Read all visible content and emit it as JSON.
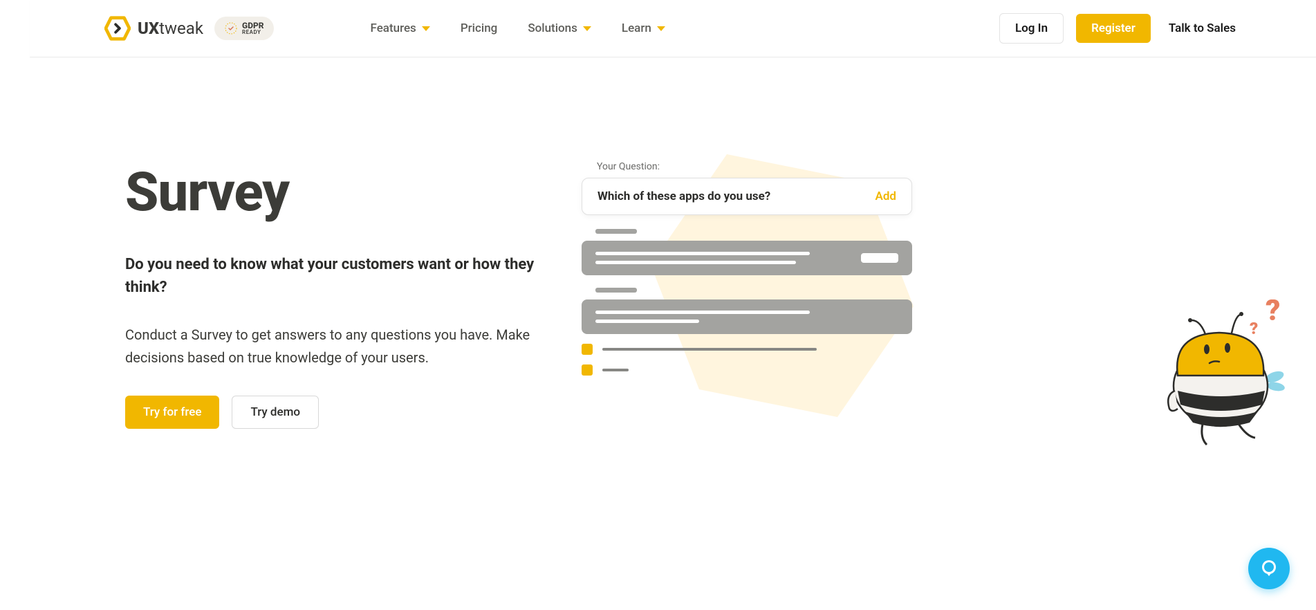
{
  "nav": {
    "logo_text_bold": "UX",
    "logo_text_light": "tweak",
    "gdpr_main": "GDPR",
    "gdpr_sub": "READY",
    "items": [
      {
        "label": "Features",
        "has_caret": true
      },
      {
        "label": "Pricing",
        "has_caret": false
      },
      {
        "label": "Solutions",
        "has_caret": true
      },
      {
        "label": "Learn",
        "has_caret": true
      }
    ],
    "login": "Log In",
    "register": "Register",
    "talk": "Talk to Sales"
  },
  "hero": {
    "title": "Survey",
    "subtitle": "Do you need to know what your customers want or how they think?",
    "description": "Conduct a Survey to get answers to any questions you have. Make decisions based on true knowledge of your users.",
    "btn_primary": "Try for free",
    "btn_secondary": "Try demo"
  },
  "illus": {
    "label": "Your Question:",
    "question": "Which of these apps do you use?",
    "add": "Add"
  }
}
